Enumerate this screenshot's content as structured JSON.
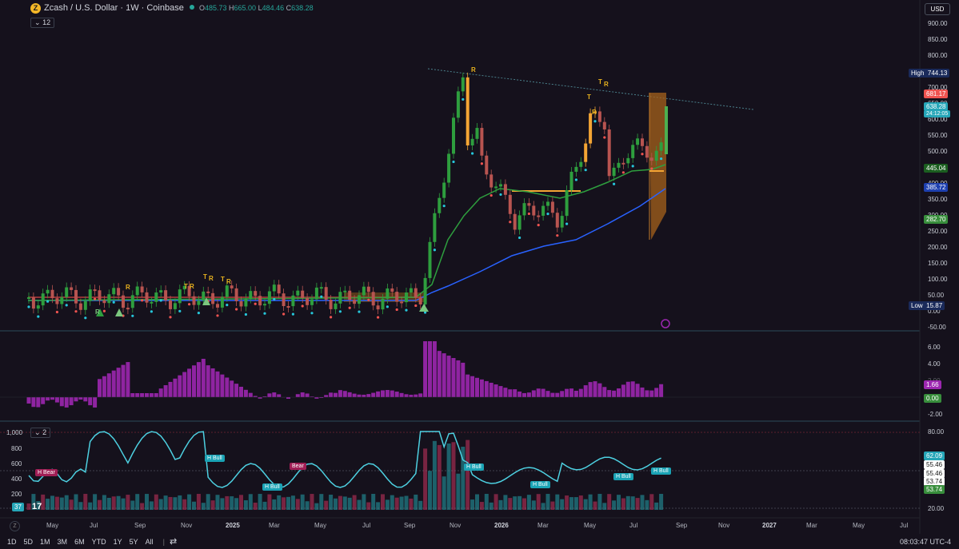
{
  "header": {
    "coin_glyph": "Z",
    "symbol_title": "Zcash / U.S. Dollar · 1W · Coinbase",
    "ohlc": [
      {
        "k": "O",
        "v": "485.73"
      },
      {
        "k": "H",
        "v": "665.00"
      },
      {
        "k": "L",
        "v": "484.46"
      },
      {
        "k": "C",
        "v": "638.28"
      }
    ],
    "indicator_count": "12",
    "currency": "USD"
  },
  "price_axis": {
    "ticks": [
      "900.00",
      "850.00",
      "800.00",
      "750.00",
      "700.00",
      "650.00",
      "600.00",
      "550.00",
      "500.00",
      "450.00",
      "400.00",
      "350.00",
      "300.00",
      "250.00",
      "200.00",
      "150.00",
      "100.00",
      "50.00",
      "0.00",
      "-50.00"
    ],
    "labels": [
      {
        "key": "High",
        "value": "744.13",
        "color": "#1e3a8a"
      },
      {
        "key": "",
        "value": "681.17",
        "color": "#ef5350"
      },
      {
        "key": "",
        "value": "638.28",
        "color": "#26c6da"
      },
      {
        "key": "",
        "value": "24:12:05",
        "color": "#26c6da"
      },
      {
        "key": "",
        "value": "445.04",
        "color": "#1b5e20"
      },
      {
        "key": "",
        "value": "385.72",
        "color": "#1e40af"
      },
      {
        "key": "",
        "value": "282.70",
        "color": "#388e3c"
      },
      {
        "key": "Low",
        "value": "15.87",
        "color": "#1e3a8a"
      }
    ]
  },
  "signals": [
    "R",
    "R",
    "T",
    "R",
    "T",
    "R",
    "T",
    "R",
    "T",
    "R",
    "T",
    "R",
    "R"
  ],
  "macd_axis": {
    "ticks": [
      "6.00",
      "4.00",
      "2.00",
      "0.00",
      "-2.00"
    ],
    "labels": [
      {
        "value": "1.66",
        "color": "#9c27b0"
      },
      {
        "value": "0.00",
        "color": "#388e3c"
      }
    ]
  },
  "rsi_panel": {
    "badge": "2",
    "left_ticks": [
      "1,000",
      "800",
      "600",
      "400",
      "200"
    ],
    "right_ticks": [
      "80.00",
      "20.00"
    ],
    "labels": [
      {
        "value": "62.09",
        "color": "#26c6da"
      },
      {
        "value": "55.46",
        "color": "#ffffff"
      },
      {
        "value": "55.46",
        "color": "#ffffff"
      },
      {
        "value": "53.74",
        "color": "#ffffff"
      },
      {
        "value": "53.74",
        "color": "#388e3c"
      }
    ],
    "volume_badge": "37",
    "pills": [
      {
        "text": "H Bear",
        "kind": "bear"
      },
      {
        "text": "H Bull",
        "kind": "bull"
      },
      {
        "text": "H Bull",
        "kind": "bull"
      },
      {
        "text": "Bear",
        "kind": "bear"
      },
      {
        "text": "H Bull",
        "kind": "bull"
      },
      {
        "text": "H Bull",
        "kind": "bull"
      },
      {
        "text": "H Bull",
        "kind": "bull"
      },
      {
        "text": "H Bull",
        "kind": "bull"
      }
    ]
  },
  "time_axis": [
    "May",
    "Jul",
    "Sep",
    "Nov",
    "2025",
    "Mar",
    "May",
    "Jul",
    "Sep",
    "Nov",
    "2026",
    "Mar",
    "May",
    "Jul",
    "Sep",
    "Nov",
    "2027",
    "Mar",
    "May",
    "Jul"
  ],
  "timeframes": [
    "1D",
    "5D",
    "1M",
    "3M",
    "6M",
    "YTD",
    "1Y",
    "5Y",
    "All"
  ],
  "clock": "08:03:47 UTC-4",
  "colors": {
    "bg": "#15111c",
    "up": "#26a69a",
    "down": "#ef5350",
    "ma_green": "#2e9e3e",
    "ma_blue": "#2962ff",
    "macd": "#9c27b0",
    "rsi": "#4dd0e1",
    "signal": "#e8b21e"
  }
}
